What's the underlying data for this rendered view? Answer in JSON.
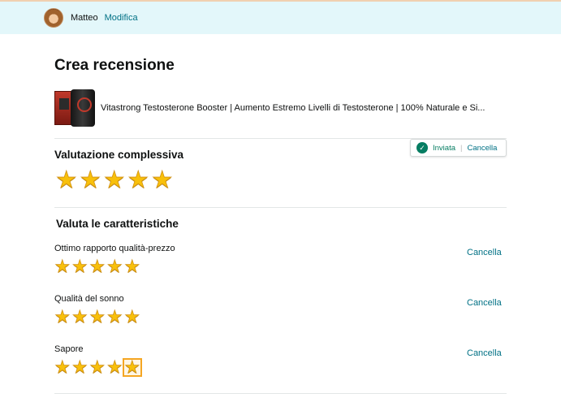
{
  "header": {
    "user_name": "Matteo",
    "edit_label": "Modifica"
  },
  "page_title": "Crea recensione",
  "product": {
    "title": "Vitastrong Testosterone Booster | Aumento Estremo Livelli di Testosterone | 100% Naturale e Si..."
  },
  "status": {
    "sent_label": "Inviata",
    "separator": "|",
    "cancel_label": "Cancella"
  },
  "overall": {
    "title": "Valutazione complessiva",
    "rating": 5,
    "max": 5
  },
  "features": {
    "title": "Valuta le caratteristiche",
    "items": [
      {
        "label": "Ottimo rapporto qualità-prezzo",
        "rating": 5,
        "cancel_label": "Cancella"
      },
      {
        "label": "Qualità del sonno",
        "rating": 5,
        "cancel_label": "Cancella"
      },
      {
        "label": "Sapore",
        "rating": 5,
        "cancel_label": "Cancella"
      }
    ]
  },
  "colors": {
    "accent_link": "#007185",
    "success": "#067d62",
    "star": "#f8c00b",
    "header_bg": "#e3f7fa"
  }
}
